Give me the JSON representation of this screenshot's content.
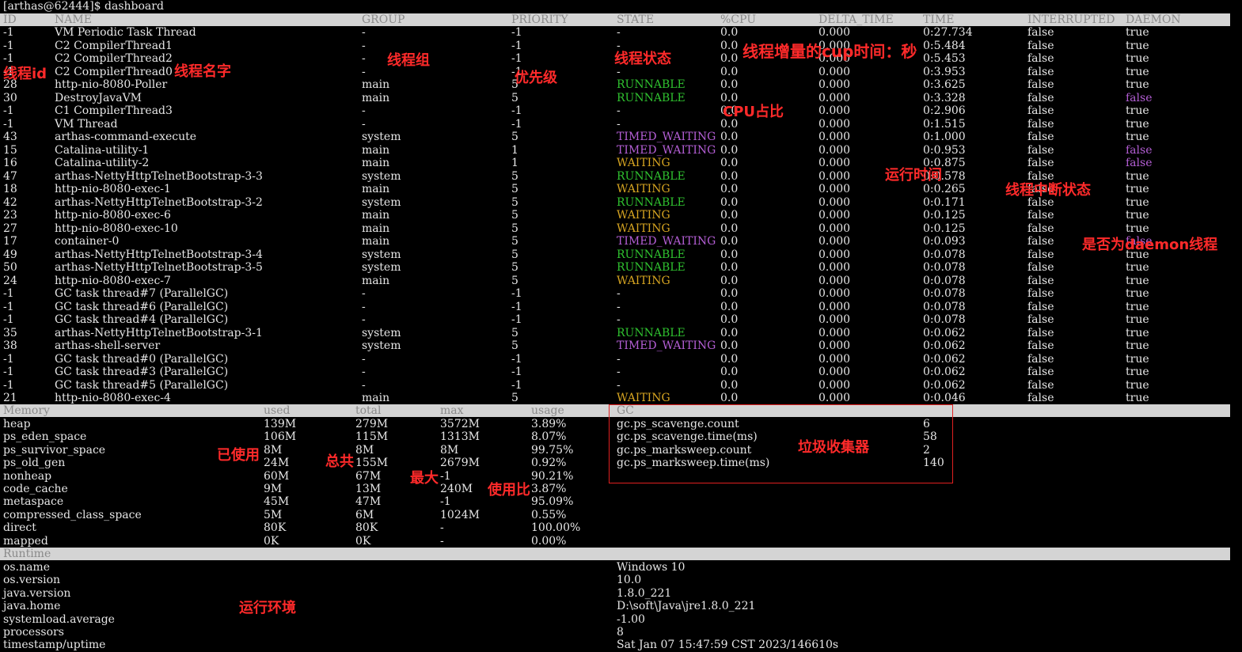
{
  "prompt": "[arthas@62444]$ dashboard",
  "thread_headers": [
    "ID",
    "NAME",
    "GROUP",
    "PRIORITY",
    "STATE",
    "%CPU",
    "DELTA_TIME",
    "TIME",
    "INTERRUPTED",
    "DAEMON"
  ],
  "threads": [
    [
      "-1",
      "VM Periodic Task Thread",
      "-",
      "-1",
      "-",
      "0.0",
      "0.000",
      "0:27.734",
      "false",
      "true"
    ],
    [
      "-1",
      "C2 CompilerThread1",
      "-",
      "-1",
      "-",
      "0.0",
      "0.000",
      "0:5.484",
      "false",
      "true"
    ],
    [
      "-1",
      "C2 CompilerThread2",
      "-",
      "-1",
      "-",
      "0.0",
      "0.000",
      "0:5.453",
      "false",
      "true"
    ],
    [
      "-1",
      "C2 CompilerThread0",
      "-",
      "-1",
      "-",
      "0.0",
      "0.000",
      "0:3.953",
      "false",
      "true"
    ],
    [
      "28",
      "http-nio-8080-Poller",
      "main",
      "5",
      "RUNNABLE",
      "0.0",
      "0.000",
      "0:3.625",
      "false",
      "true"
    ],
    [
      "30",
      "DestroyJavaVM",
      "main",
      "5",
      "RUNNABLE",
      "0.0",
      "0.000",
      "0:3.328",
      "false",
      "false"
    ],
    [
      "-1",
      "C1 CompilerThread3",
      "-",
      "-1",
      "-",
      "0.0",
      "0.000",
      "0:2.906",
      "false",
      "true"
    ],
    [
      "-1",
      "VM Thread",
      "-",
      "-1",
      "-",
      "0.0",
      "0.000",
      "0:1.515",
      "false",
      "true"
    ],
    [
      "43",
      "arthas-command-execute",
      "system",
      "5",
      "TIMED_WAITING",
      "0.0",
      "0.000",
      "0:1.000",
      "false",
      "true"
    ],
    [
      "15",
      "Catalina-utility-1",
      "main",
      "1",
      "TIMED_WAITING",
      "0.0",
      "0.000",
      "0:0.953",
      "false",
      "false"
    ],
    [
      "16",
      "Catalina-utility-2",
      "main",
      "1",
      "WAITING",
      "0.0",
      "0.000",
      "0:0.875",
      "false",
      "false"
    ],
    [
      "47",
      "arthas-NettyHttpTelnetBootstrap-3-3",
      "system",
      "5",
      "RUNNABLE",
      "0.0",
      "0.000",
      "0:0.578",
      "false",
      "true"
    ],
    [
      "18",
      "http-nio-8080-exec-1",
      "main",
      "5",
      "WAITING",
      "0.0",
      "0.000",
      "0:0.265",
      "false",
      "true"
    ],
    [
      "42",
      "arthas-NettyHttpTelnetBootstrap-3-2",
      "system",
      "5",
      "RUNNABLE",
      "0.0",
      "0.000",
      "0:0.171",
      "false",
      "true"
    ],
    [
      "23",
      "http-nio-8080-exec-6",
      "main",
      "5",
      "WAITING",
      "0.0",
      "0.000",
      "0:0.125",
      "false",
      "true"
    ],
    [
      "27",
      "http-nio-8080-exec-10",
      "main",
      "5",
      "WAITING",
      "0.0",
      "0.000",
      "0:0.125",
      "false",
      "true"
    ],
    [
      "17",
      "container-0",
      "main",
      "5",
      "TIMED_WAITING",
      "0.0",
      "0.000",
      "0:0.093",
      "false",
      "false"
    ],
    [
      "49",
      "arthas-NettyHttpTelnetBootstrap-3-4",
      "system",
      "5",
      "RUNNABLE",
      "0.0",
      "0.000",
      "0:0.078",
      "false",
      "true"
    ],
    [
      "50",
      "arthas-NettyHttpTelnetBootstrap-3-5",
      "system",
      "5",
      "RUNNABLE",
      "0.0",
      "0.000",
      "0:0.078",
      "false",
      "true"
    ],
    [
      "24",
      "http-nio-8080-exec-7",
      "main",
      "5",
      "WAITING",
      "0.0",
      "0.000",
      "0:0.078",
      "false",
      "true"
    ],
    [
      "-1",
      "GC task thread#7 (ParallelGC)",
      "-",
      "-1",
      "-",
      "0.0",
      "0.000",
      "0:0.078",
      "false",
      "true"
    ],
    [
      "-1",
      "GC task thread#6 (ParallelGC)",
      "-",
      "-1",
      "-",
      "0.0",
      "0.000",
      "0:0.078",
      "false",
      "true"
    ],
    [
      "-1",
      "GC task thread#4 (ParallelGC)",
      "-",
      "-1",
      "-",
      "0.0",
      "0.000",
      "0:0.078",
      "false",
      "true"
    ],
    [
      "35",
      "arthas-NettyHttpTelnetBootstrap-3-1",
      "system",
      "5",
      "RUNNABLE",
      "0.0",
      "0.000",
      "0:0.062",
      "false",
      "true"
    ],
    [
      "38",
      "arthas-shell-server",
      "system",
      "5",
      "TIMED_WAITING",
      "0.0",
      "0.000",
      "0:0.062",
      "false",
      "true"
    ],
    [
      "-1",
      "GC task thread#0 (ParallelGC)",
      "-",
      "-1",
      "-",
      "0.0",
      "0.000",
      "0:0.062",
      "false",
      "true"
    ],
    [
      "-1",
      "GC task thread#3 (ParallelGC)",
      "-",
      "-1",
      "-",
      "0.0",
      "0.000",
      "0:0.062",
      "false",
      "true"
    ],
    [
      "-1",
      "GC task thread#5 (ParallelGC)",
      "-",
      "-1",
      "-",
      "0.0",
      "0.000",
      "0:0.062",
      "false",
      "true"
    ],
    [
      "21",
      "http-nio-8080-exec-4",
      "main",
      "5",
      "WAITING",
      "0.0",
      "0.000",
      "0:0.046",
      "false",
      "true"
    ]
  ],
  "memory_headers": [
    "Memory",
    "used",
    "total",
    "max",
    "usage"
  ],
  "memory": [
    [
      "heap",
      "139M",
      "279M",
      "3572M",
      "3.89%"
    ],
    [
      "ps_eden_space",
      "106M",
      "115M",
      "1313M",
      "8.07%"
    ],
    [
      "ps_survivor_space",
      "8M",
      "8M",
      "8M",
      "99.75%"
    ],
    [
      "ps_old_gen",
      "24M",
      "155M",
      "2679M",
      "0.92%"
    ],
    [
      "nonheap",
      "60M",
      "67M",
      "-1",
      "90.21%"
    ],
    [
      "code_cache",
      "9M",
      "13M",
      "240M",
      "3.87%"
    ],
    [
      "metaspace",
      "45M",
      "47M",
      "-1",
      "95.09%"
    ],
    [
      "compressed_class_space",
      "5M",
      "6M",
      "1024M",
      "0.55%"
    ],
    [
      "direct",
      "80K",
      "80K",
      "-",
      "100.00%"
    ],
    [
      "mapped",
      "0K",
      "0K",
      "-",
      "0.00%"
    ]
  ],
  "gc_header": "GC",
  "gc": [
    [
      "gc.ps_scavenge.count",
      "6"
    ],
    [
      "gc.ps_scavenge.time(ms)",
      "58"
    ],
    [
      "gc.ps_marksweep.count",
      "2"
    ],
    [
      "gc.ps_marksweep.time(ms)",
      "140"
    ]
  ],
  "runtime_header": "Runtime",
  "runtime": [
    [
      "os.name",
      "Windows 10"
    ],
    [
      "os.version",
      "10.0"
    ],
    [
      "java.version",
      "1.8.0_221"
    ],
    [
      "java.home",
      "D:\\soft\\Java\\jre1.8.0_221"
    ],
    [
      "systemload.average",
      "-1.00"
    ],
    [
      "processors",
      "8"
    ],
    [
      "timestamp/uptime",
      "Sat Jan 07 15:47:59 CST 2023/146610s"
    ]
  ],
  "annotations": {
    "thread_id": "线程id",
    "thread_name": "线程名字",
    "thread_group": "线程组",
    "priority": "优先级",
    "state": "线程状态",
    "delta_time": "线程增量的cup时间：秒",
    "cpu": "CPU占比",
    "run_time": "运行时间",
    "interrupted": "线程中断状态",
    "daemon": "是否为daemon线程",
    "used": "已使用",
    "total": "总共",
    "max": "最大",
    "usage": "使用比",
    "gc": "垃圾收集器",
    "runtime": "运行环境"
  },
  "colors": {
    "runnable": "#2fc12f",
    "timed_waiting": "#b35ed4",
    "waiting": "#d6a421",
    "annotation": "#ff2a2a"
  }
}
